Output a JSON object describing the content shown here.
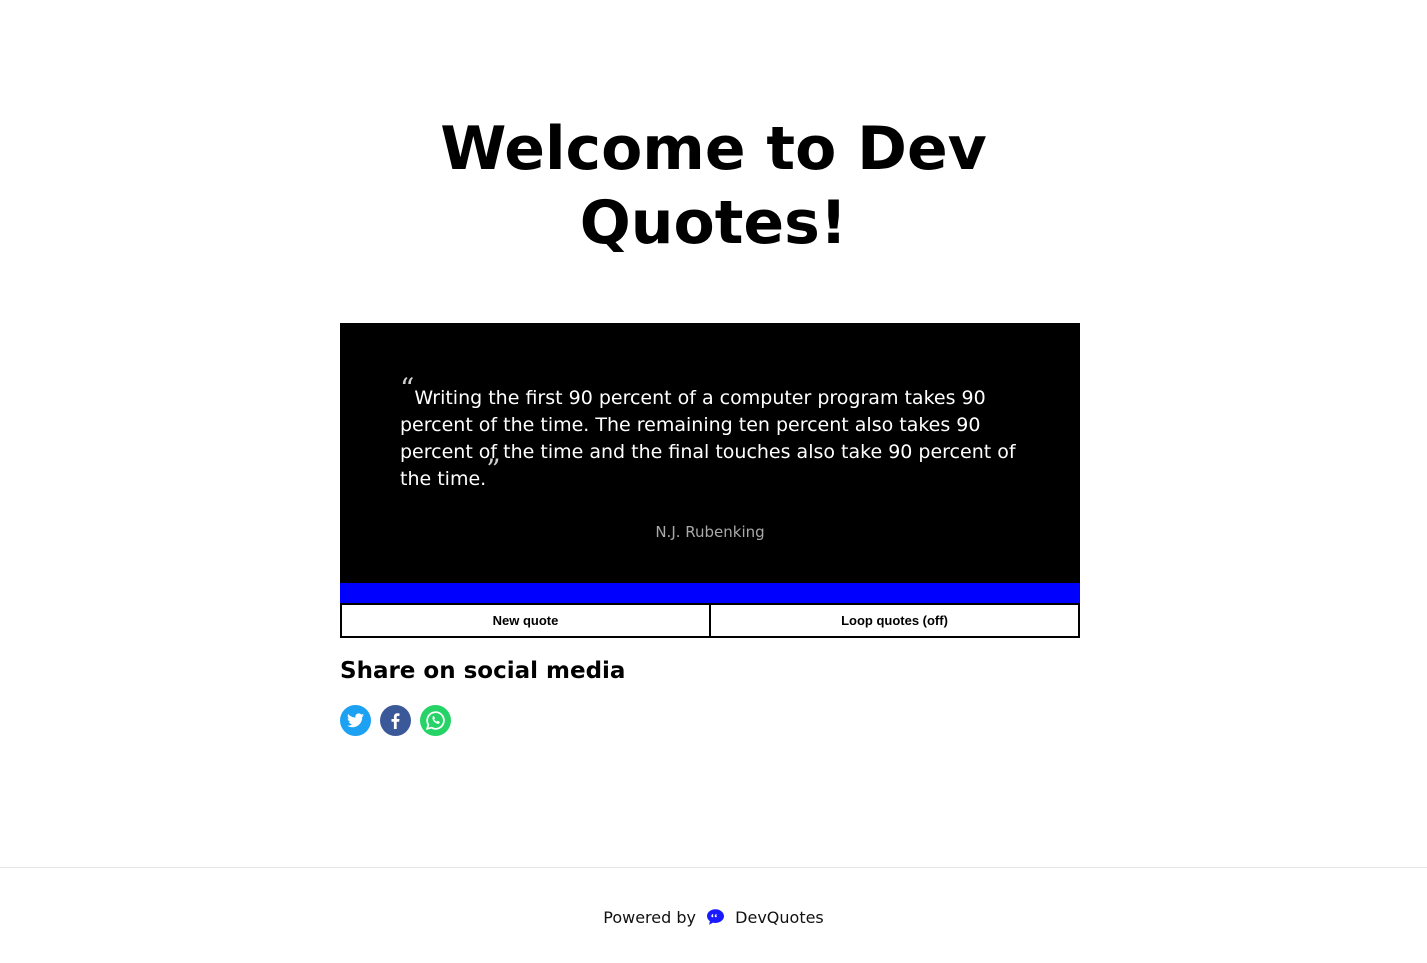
{
  "header": {
    "title_line1": "Welcome to Dev",
    "title_line2": "Quotes!"
  },
  "quote": {
    "open_mark": "“",
    "text": "Writing the first 90 percent of a computer program takes 90 percent of the time. The remaining ten percent also takes 90 percent of the time and the final touches also take 90 percent of the time.",
    "close_mark": "”",
    "author": "N.J. Rubenking",
    "progress": 1.0
  },
  "controls": {
    "new_quote_label": "New quote",
    "loop_label": "Loop quotes (off)"
  },
  "share": {
    "heading": "Share on social media",
    "icons": [
      "twitter-icon",
      "facebook-icon",
      "whatsapp-icon"
    ]
  },
  "footer": {
    "powered_by": "Powered by",
    "brand": "DevQuotes",
    "logo_icon": "quote-bubble-icon"
  },
  "colors": {
    "card_bg": "#000000",
    "progress": "#0000ff",
    "twitter": "#1da1f2",
    "facebook": "#3b5998",
    "whatsapp": "#25d366",
    "brand": "#1a1aff"
  }
}
